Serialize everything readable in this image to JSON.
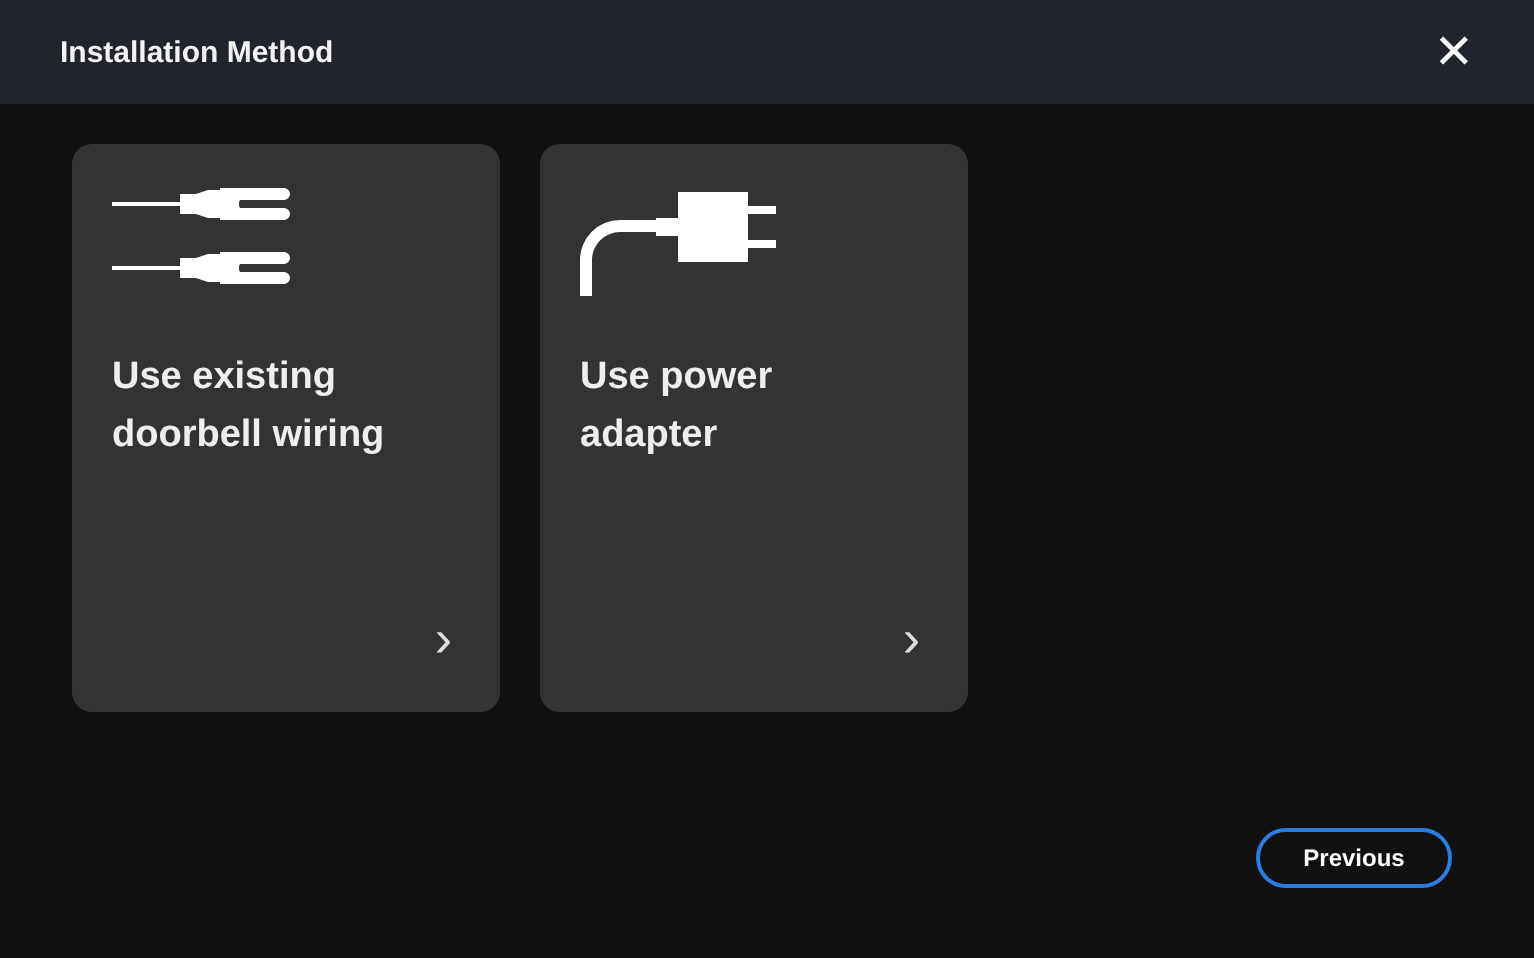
{
  "window": {
    "title": "Installation Method",
    "close": "✕"
  },
  "options": [
    {
      "kind": "wires",
      "title": "Use existing doorbell wiring",
      "chevron": "›"
    },
    {
      "kind": "plug",
      "title": "Use power adapter",
      "chevron": "›"
    }
  ],
  "buttons": [
    {
      "label": "Previous"
    }
  ]
}
